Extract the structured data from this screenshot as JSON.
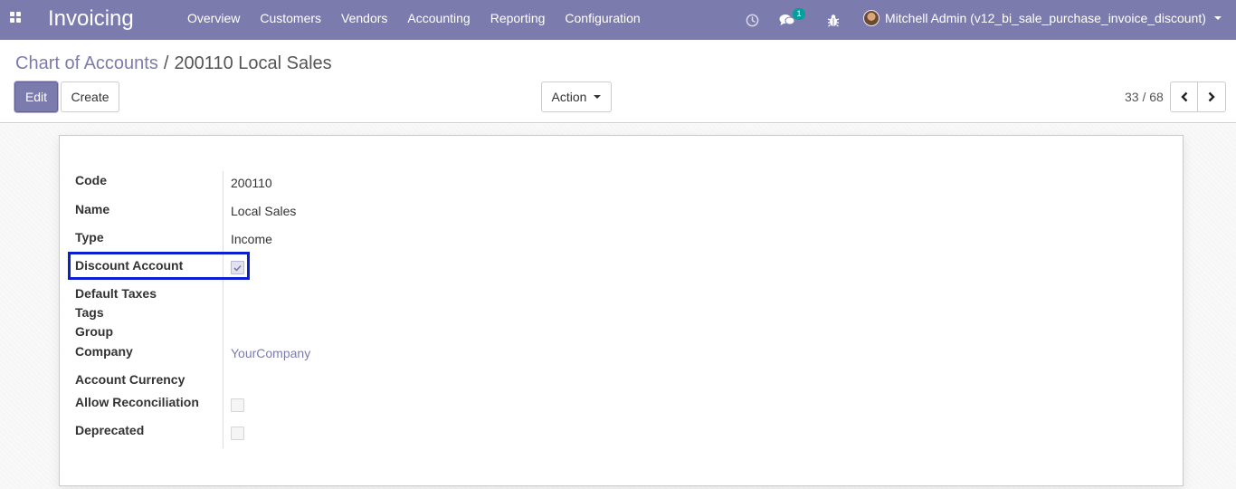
{
  "navbar": {
    "app_title": "Invoicing",
    "menu": [
      "Overview",
      "Customers",
      "Vendors",
      "Accounting",
      "Reporting",
      "Configuration"
    ],
    "chat_count": "1",
    "user_label": "Mitchell Admin (v12_bi_sale_purchase_invoice_discount)"
  },
  "breadcrumb": {
    "parent": "Chart of Accounts",
    "separator": "/",
    "current": "200110 Local Sales"
  },
  "buttons": {
    "edit": "Edit",
    "create": "Create",
    "action": "Action"
  },
  "pager": {
    "text": "33 / 68"
  },
  "form": {
    "fields": [
      {
        "label": "Code",
        "value": "200110"
      },
      {
        "label": "Name",
        "value": "Local Sales"
      },
      {
        "label": "Type",
        "value": "Income"
      },
      {
        "label": "Discount Account",
        "checked": true
      },
      {
        "label": "Default Taxes",
        "value": ""
      },
      {
        "label": "Tags",
        "value": ""
      },
      {
        "label": "Group",
        "value": ""
      },
      {
        "label": "Company",
        "value": "YourCompany"
      },
      {
        "label": "Account Currency",
        "value": ""
      },
      {
        "label": "Allow Reconciliation",
        "checked": false
      },
      {
        "label": "Deprecated",
        "checked": false
      }
    ]
  },
  "colors": {
    "brand": "#7c7bad",
    "highlight": "#0a1fcf",
    "badge": "#00a09d"
  }
}
